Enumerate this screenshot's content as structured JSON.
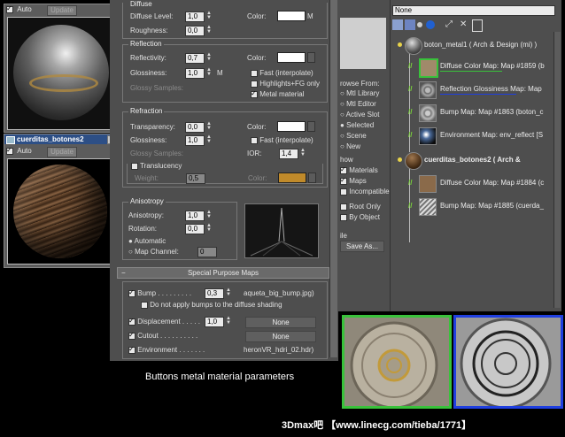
{
  "material_window_1": {
    "auto_label": "Auto",
    "update_label": "Update"
  },
  "material_window_2": {
    "title": "cuerditas_botones2",
    "close": "✕",
    "auto_label": "Auto",
    "update_label": "Update"
  },
  "diffuse": {
    "title": "Diffuse",
    "level_label": "Diffuse Level:",
    "level_value": "1,0",
    "roughness_label": "Roughness:",
    "roughness_value": "0,0",
    "color_label": "Color:",
    "m_label": "M",
    "color": "#ffffff"
  },
  "reflection": {
    "title": "Reflection",
    "reflectivity_label": "Reflectivity:",
    "reflectivity_value": "0,7",
    "glossiness_label": "Glossiness:",
    "glossiness_value": "1,0",
    "m_label": "M",
    "glossy_samples_label": "Glossy Samples:",
    "color_label": "Color:",
    "fast_label": "Fast (interpolate)",
    "highlights_label": "Highlights+FG only",
    "metal_label": "Metal material"
  },
  "refraction": {
    "title": "Refraction",
    "transparency_label": "Transparency:",
    "transparency_value": "0,0",
    "glossiness_label": "Glossiness:",
    "glossiness_value": "1,0",
    "glossy_samples_label": "Glossy Samples:",
    "color_label": "Color:",
    "fast_label": "Fast (interpolate)",
    "ior_label": "IOR:",
    "ior_value": "1,4"
  },
  "translucency": {
    "label": "Translucency",
    "weight_label": "Weight:",
    "weight_value": "0,5",
    "color_label": "Color:",
    "color": "#c08a2a"
  },
  "anisotropy": {
    "title": "Anisotropy",
    "anisotropy_label": "Anisotropy:",
    "anisotropy_value": "1,0",
    "rotation_label": "Rotation:",
    "rotation_value": "0,0",
    "automatic_label": "Automatic",
    "map_channel_label": "Map Channel:",
    "map_channel_value": "0"
  },
  "special": {
    "title": "Special Purpose Maps",
    "bump_label": "Bump . . . . . . . . .",
    "bump_value": "0,3",
    "bump_map": "aqueta_big_bump.jpg)",
    "no_diffuse_label": "Do not apply bumps to the diffuse shading",
    "displacement_label": "Displacement . . . . .",
    "displacement_value": "1,0",
    "displacement_map": "None",
    "cutout_label": "Cutout . . . . . . . . . .",
    "cutout_map": "None",
    "environment_label": "Environment . . . . . . .",
    "environment_map": "heronVR_hdri_02.hdr)"
  },
  "caption": "Buttons metal material parameters",
  "browser": {
    "none_field": "None",
    "browse_from_label": "rowse From:",
    "browse_items": [
      "Mtl Library",
      "Mtl Editor",
      "Active Slot",
      "Selected",
      "Scene",
      "New"
    ],
    "show_label": "how",
    "show_items": [
      "Materials",
      "Maps",
      "Incompatible"
    ],
    "root_only": "Root Only",
    "by_object": "By Object",
    "file_label": "ile",
    "save_as": "Save As..."
  },
  "tree": [
    {
      "label": "boton_metal1  ( Arch & Design (mi) )",
      "level": 0
    },
    {
      "label": "Diffuse Color Map: Map #1859 (b",
      "level": 1
    },
    {
      "label": "Reflection Glossiness Map: Map",
      "level": 1
    },
    {
      "label": "Bump Map: Map #1863 (boton_c",
      "level": 1
    },
    {
      "label": "Environment Map: env_reflect [S",
      "level": 1
    },
    {
      "label": "cuerditas_botones2  ( Arch &",
      "level": 0
    },
    {
      "label": "Diffuse Color Map: Map #1884 (c",
      "level": 1
    },
    {
      "label": "Bump Map: Map #1885 (cuerda_",
      "level": 1
    }
  ],
  "watermark": "3Dmax吧 【www.linecg.com/tieba/1771】",
  "colors": {
    "title_blue": "#2d4f86",
    "green_frame": "#39c23b",
    "blue_frame": "#1f3fe0",
    "copper": "#c08a2a"
  }
}
